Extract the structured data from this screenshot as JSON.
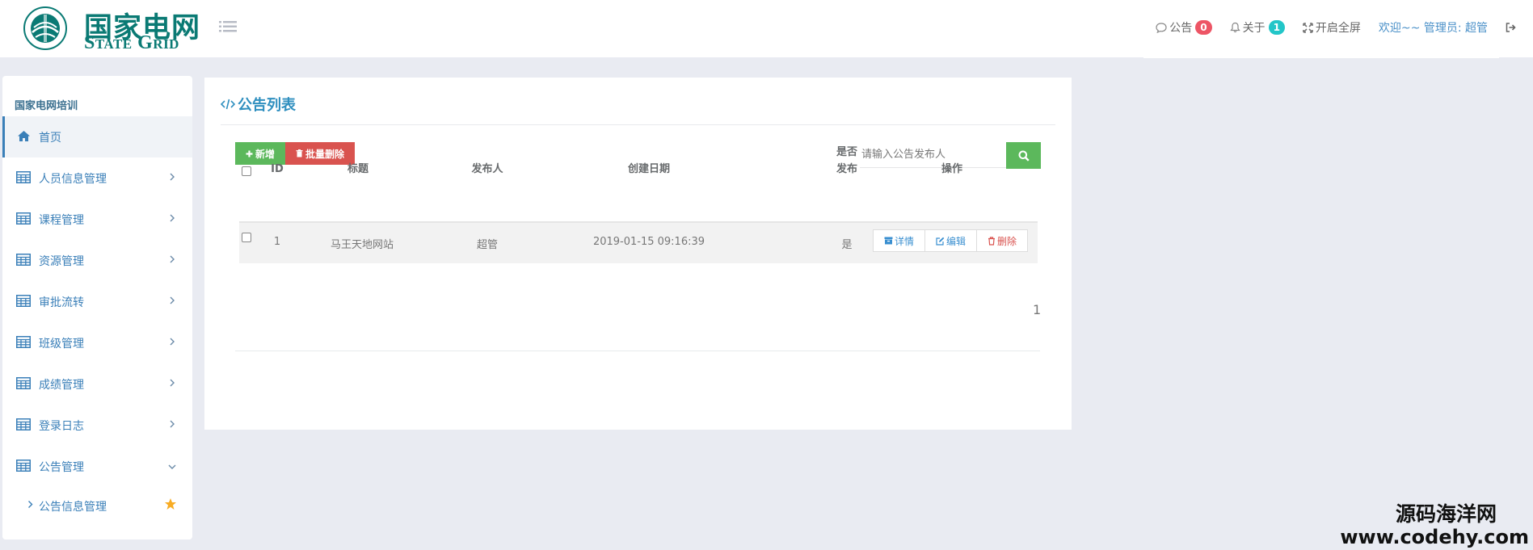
{
  "header": {
    "logo_cn": "国家电网",
    "logo_en": "State Grid",
    "nav": {
      "notice_label": "公告",
      "notice_count": "0",
      "about_label": "关于",
      "about_count": "1",
      "fullscreen_label": "开启全屏",
      "welcome_text": "欢迎~~ 管理员: 超管"
    }
  },
  "sidebar": {
    "title": "国家电网培训",
    "items": [
      {
        "label": "首页",
        "icon": "home-icon",
        "active": true
      },
      {
        "label": "人员信息管理",
        "icon": "table-icon"
      },
      {
        "label": "课程管理",
        "icon": "table-icon"
      },
      {
        "label": "资源管理",
        "icon": "table-icon"
      },
      {
        "label": "审批流转",
        "icon": "table-icon"
      },
      {
        "label": "班级管理",
        "icon": "table-icon"
      },
      {
        "label": "成绩管理",
        "icon": "table-icon"
      },
      {
        "label": "登录日志",
        "icon": "table-icon"
      },
      {
        "label": "公告管理",
        "icon": "table-icon",
        "expanded": true
      }
    ],
    "subitem": {
      "label": "公告信息管理",
      "icon": "star-icon"
    }
  },
  "main": {
    "title": "公告列表",
    "add_label": "新增",
    "batch_delete_label": "批量删除",
    "search_placeholder": "请输入公告发布人",
    "table": {
      "headers": {
        "id": "ID",
        "title": "标题",
        "publisher": "发布人",
        "created": "创建日期",
        "published_line1": "是否",
        "published_line2": "发布",
        "actions": "操作"
      },
      "rows": [
        {
          "id": "1",
          "title": "马王天地网站",
          "publisher": "超管",
          "created": "2019-01-15 09:16:39",
          "published": "是"
        }
      ],
      "actions": {
        "detail": "详情",
        "edit": "编辑",
        "delete": "删除"
      }
    },
    "pagination": {
      "current": "1"
    }
  },
  "watermark": {
    "cn": "源码海洋网",
    "url": "www.codehy.com"
  },
  "colors": {
    "primary": "#3a7fb8",
    "success": "#5cb85c",
    "danger": "#d9534f",
    "title": "#2f8fbf",
    "logo": "#0a7a74"
  }
}
